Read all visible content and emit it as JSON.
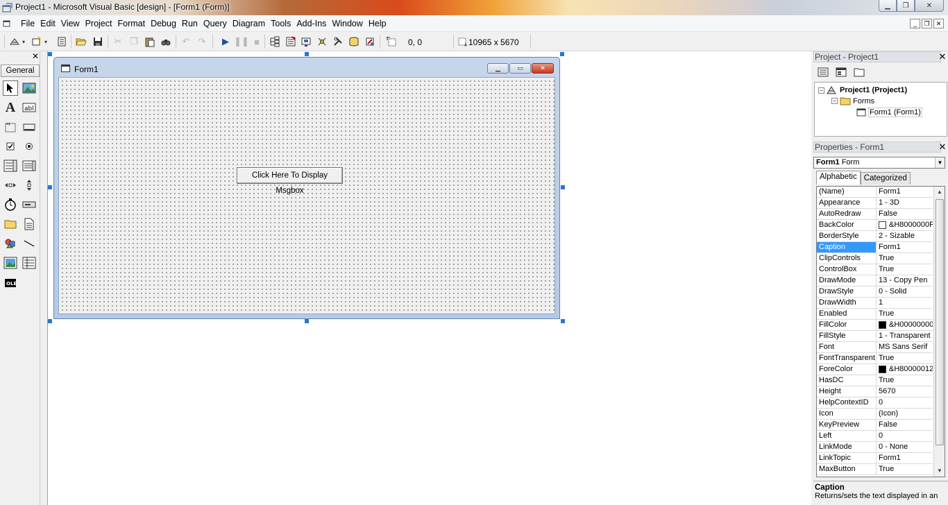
{
  "window": {
    "title": "Project1 - Microsoft Visual Basic [design] - [Form1 (Form)]"
  },
  "menu": {
    "items": [
      "File",
      "Edit",
      "View",
      "Project",
      "Format",
      "Debug",
      "Run",
      "Query",
      "Diagram",
      "Tools",
      "Add-Ins",
      "Window",
      "Help"
    ]
  },
  "toolbar": {
    "position_readout": "0, 0",
    "size_readout": "10965 x 5670"
  },
  "toolbox": {
    "tab_label": "General",
    "close_glyph": "✕",
    "tools": [
      "pointer-tool",
      "picturebox-tool",
      "label-tool",
      "textbox-tool",
      "frame-tool",
      "commandbutton-tool",
      "checkbox-tool",
      "optionbutton-tool",
      "combobox-tool",
      "listbox-tool",
      "hscrollbar-tool",
      "vscrollbar-tool",
      "timer-tool",
      "drivelistbox-tool",
      "dirlistbox-tool",
      "filelistbox-tool",
      "shape-tool",
      "line-tool",
      "image-tool",
      "data-tool",
      "ole-tool"
    ]
  },
  "form": {
    "caption": "Form1",
    "button_caption": "Click Here To Display Msgbox"
  },
  "project": {
    "header": "Project - Project1",
    "close_glyph": "✕",
    "tree": {
      "root": "Project1 (Project1)",
      "folder": "Forms",
      "item": "Form1 (Form1)"
    }
  },
  "properties": {
    "header": "Properties - Form1",
    "close_glyph": "✕",
    "object_name": "Form1",
    "object_type": "Form",
    "tabs": [
      "Alphabetic",
      "Categorized"
    ],
    "selected_property": "Caption",
    "rows": [
      {
        "name": "(Name)",
        "value": "Form1"
      },
      {
        "name": "Appearance",
        "value": "1 - 3D"
      },
      {
        "name": "AutoRedraw",
        "value": "False"
      },
      {
        "name": "BackColor",
        "value": "&H8000000F",
        "swatch": "#ffffff"
      },
      {
        "name": "BorderStyle",
        "value": "2 - Sizable"
      },
      {
        "name": "Caption",
        "value": "Form1"
      },
      {
        "name": "ClipControls",
        "value": "True"
      },
      {
        "name": "ControlBox",
        "value": "True"
      },
      {
        "name": "DrawMode",
        "value": "13 - Copy Pen"
      },
      {
        "name": "DrawStyle",
        "value": "0 - Solid"
      },
      {
        "name": "DrawWidth",
        "value": "1"
      },
      {
        "name": "Enabled",
        "value": "True"
      },
      {
        "name": "FillColor",
        "value": "&H00000000",
        "swatch": "#000000"
      },
      {
        "name": "FillStyle",
        "value": "1 - Transparent"
      },
      {
        "name": "Font",
        "value": "MS Sans Serif"
      },
      {
        "name": "FontTransparent",
        "value": "True"
      },
      {
        "name": "ForeColor",
        "value": "&H80000012",
        "swatch": "#000000"
      },
      {
        "name": "HasDC",
        "value": "True"
      },
      {
        "name": "Height",
        "value": "5670"
      },
      {
        "name": "HelpContextID",
        "value": "0"
      },
      {
        "name": "Icon",
        "value": "(Icon)"
      },
      {
        "name": "KeyPreview",
        "value": "False"
      },
      {
        "name": "Left",
        "value": "0"
      },
      {
        "name": "LinkMode",
        "value": "0 - None"
      },
      {
        "name": "LinkTopic",
        "value": "Form1"
      },
      {
        "name": "MaxButton",
        "value": "True"
      }
    ],
    "description": {
      "title": "Caption",
      "text": "Returns/sets the text displayed in an"
    }
  },
  "colors": {
    "selection": "#3399ff",
    "handle": "#2b76d0"
  }
}
